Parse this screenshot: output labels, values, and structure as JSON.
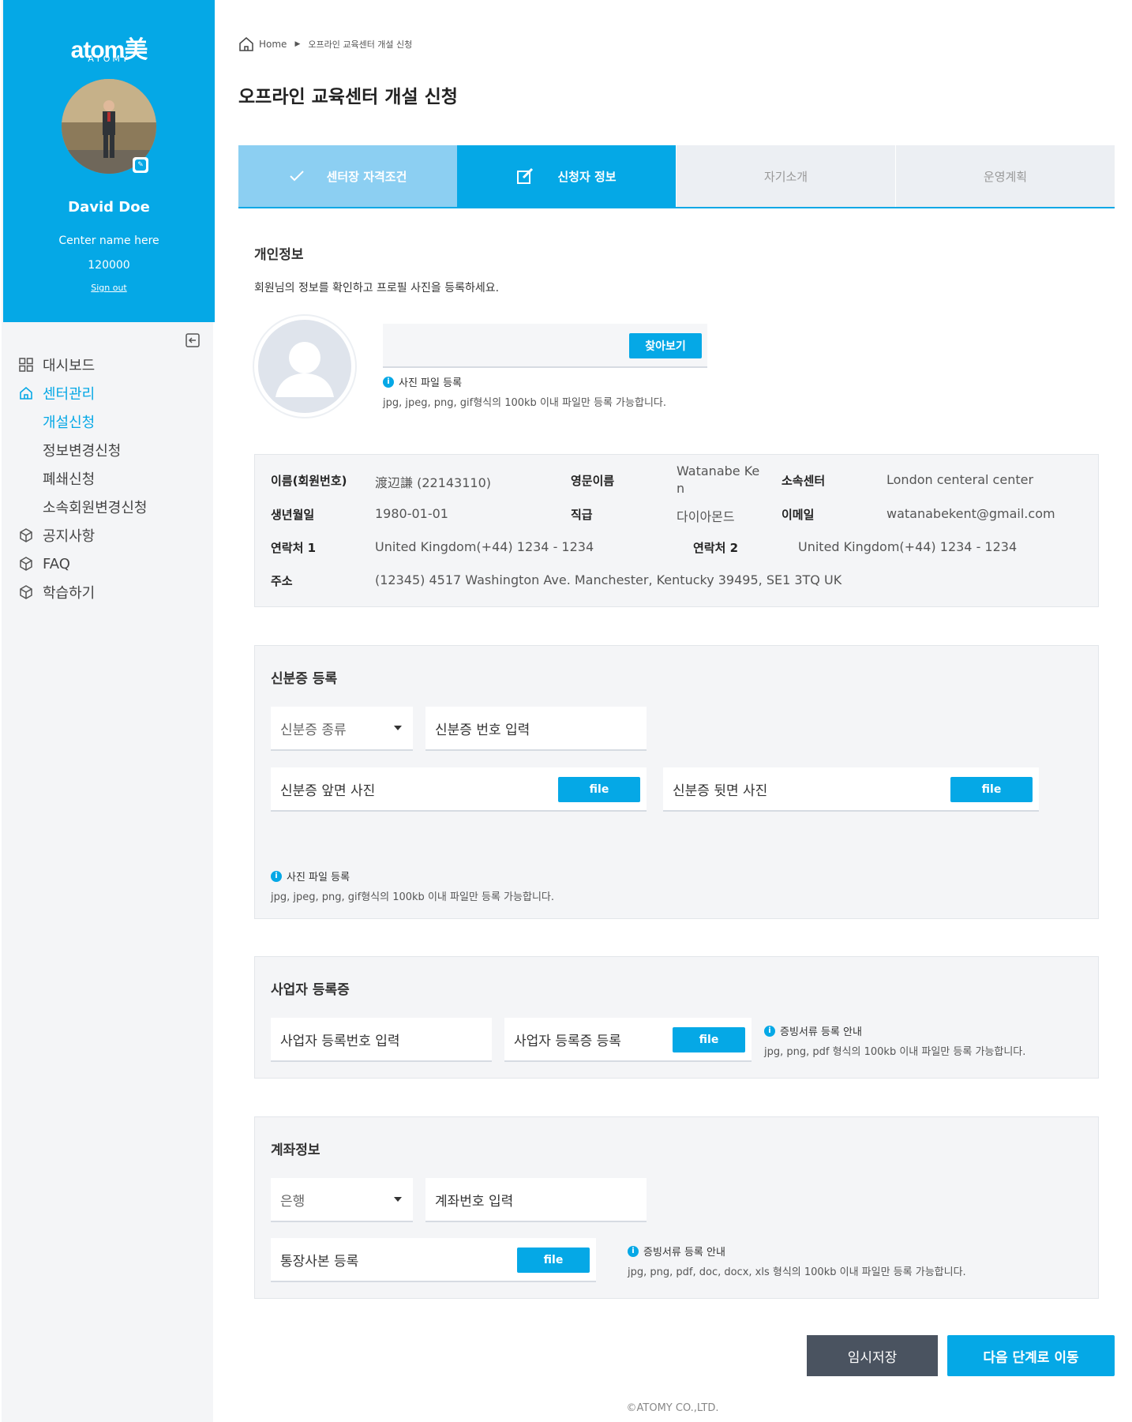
{
  "sidebar": {
    "logo": "atom美",
    "logo_sub": "ATOMY",
    "name": "David Doe",
    "center_name": "Center name here",
    "member_no": "120000",
    "sign_out": "Sign out",
    "nav": [
      {
        "label": "대시보드",
        "icon": "grid-icon"
      },
      {
        "label": "센터관리",
        "icon": "home-icon"
      },
      {
        "label": "공지사항",
        "icon": "box-icon"
      },
      {
        "label": "FAQ",
        "icon": "box-icon"
      },
      {
        "label": "학습하기",
        "icon": "box-icon"
      }
    ],
    "sub_nav": [
      "개설신청",
      "정보변경신청",
      "폐쇄신청",
      "소속회원변경신청"
    ]
  },
  "breadcrumb": {
    "home": "Home",
    "current": "오프라인 교육센터 개설 신청"
  },
  "page_title": "오프라인 교육센터 개설 신청",
  "steps": [
    "센터장 자격조건",
    "신청자 정보",
    "자기소개",
    "운영계획"
  ],
  "personal": {
    "title": "개인정보",
    "desc": "회원님의 정보를 확인하고 프로필 사진을 등록하세요.",
    "browse_btn": "찾아보기",
    "hint_title": "사진 파일 등록",
    "hint_text": "jpg, jpeg, png, gif형식의 100kb 이내 파일만 등록 가능합니다."
  },
  "info": {
    "name_label": "이름(회원번호)",
    "name_value": "渡辺謙 (22143110)",
    "en_label": "영문이름",
    "en_value": "Watanabe Ke n",
    "center_label": "소속센터",
    "center_value": "London centeral center",
    "birth_label": "생년월일",
    "birth_value": "1980-01-01",
    "rank_label": "직급",
    "rank_value": "다이아몬드",
    "email_label": "이메일",
    "email_value": "watanabekent@gmail.com",
    "phone1_label": "연락처 1",
    "phone1_value": "United Kingdom(+44) 1234 - 1234",
    "phone2_label": "연락처 2",
    "phone2_value": "United Kingdom(+44) 1234 - 1234",
    "addr_label": "주소",
    "addr_value": "(12345) 4517 Washington Ave. Manchester, Kentucky 39495, SE1 3TQ UK"
  },
  "id_card": {
    "title": "신분증 등록",
    "type_placeholder": "신분증 종류",
    "number_placeholder": "신분증 번호 입력",
    "front_label": "신분증 앞면 사진",
    "back_label": "신분증 뒷면 사진",
    "file_btn": "file",
    "hint_title": "사진 파일 등록",
    "hint_text": "jpg, jpeg, png, gif형식의 100kb 이내 파일만 등록 가능합니다."
  },
  "business": {
    "title": "사업자 등록증",
    "number_placeholder": "사업자 등록번호 입력",
    "cert_label": "사업자 등록증 등록",
    "file_btn": "file",
    "hint_title": "증빙서류 등록 안내",
    "hint_text": "jpg, png, pdf 형식의 100kb 이내 파일만 등록 가능합니다."
  },
  "account": {
    "title": "계좌정보",
    "bank_placeholder": "은행",
    "number_placeholder": "계좌번호 입력",
    "bankbook_label": "통장사본 등록",
    "file_btn": "file",
    "hint_title": "증빙서류 등록 안내",
    "hint_text": "jpg, png, pdf, doc, docx, xls 형식의 100kb 이내 파일만 등록 가능합니다."
  },
  "buttons": {
    "save": "임시저장",
    "next": "다음 단계로 이동"
  },
  "copyright": "©ATOMY CO.,LTD.",
  "colors": {
    "accent": "#05a8e6",
    "dark": "#4a5360",
    "light_step": "#8ccff2"
  }
}
